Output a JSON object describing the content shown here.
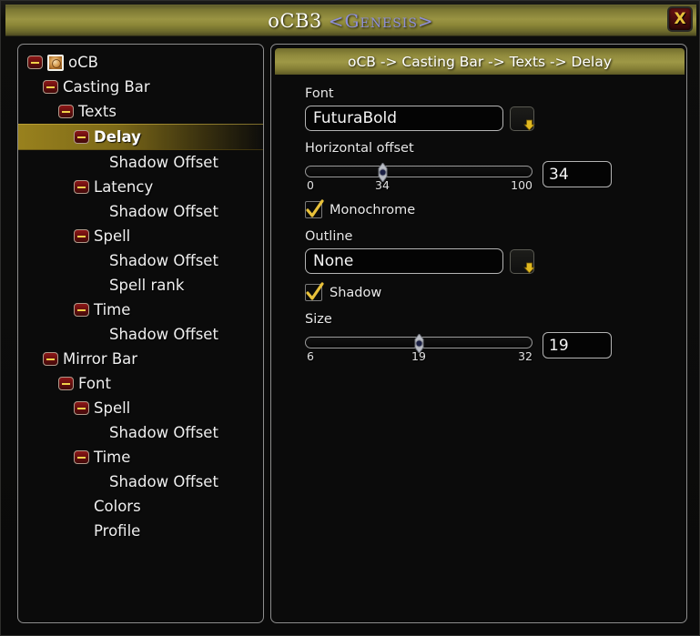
{
  "window": {
    "title_main": "oCB3",
    "title_guild": "<Genesis>",
    "close_label": "X"
  },
  "tree": {
    "items": [
      {
        "label": "oCB",
        "indent": 0,
        "toggle": true,
        "icon": "addon-icon",
        "selected": false
      },
      {
        "label": "Casting Bar",
        "indent": 1,
        "toggle": true,
        "icon": null,
        "selected": false
      },
      {
        "label": "Texts",
        "indent": 2,
        "toggle": true,
        "icon": null,
        "selected": false
      },
      {
        "label": "Delay",
        "indent": 3,
        "toggle": true,
        "icon": null,
        "selected": true
      },
      {
        "label": "Shadow Offset",
        "indent": 4,
        "toggle": false,
        "icon": null,
        "selected": false
      },
      {
        "label": "Latency",
        "indent": 3,
        "toggle": true,
        "icon": null,
        "selected": false
      },
      {
        "label": "Shadow Offset",
        "indent": 4,
        "toggle": false,
        "icon": null,
        "selected": false
      },
      {
        "label": "Spell",
        "indent": 3,
        "toggle": true,
        "icon": null,
        "selected": false
      },
      {
        "label": "Shadow Offset",
        "indent": 4,
        "toggle": false,
        "icon": null,
        "selected": false
      },
      {
        "label": "Spell rank",
        "indent": 4,
        "toggle": false,
        "icon": null,
        "selected": false
      },
      {
        "label": "Time",
        "indent": 3,
        "toggle": true,
        "icon": null,
        "selected": false
      },
      {
        "label": "Shadow Offset",
        "indent": 4,
        "toggle": false,
        "icon": null,
        "selected": false
      },
      {
        "label": "Mirror Bar",
        "indent": 1,
        "toggle": true,
        "icon": null,
        "selected": false
      },
      {
        "label": "Font",
        "indent": 2,
        "toggle": true,
        "icon": null,
        "selected": false
      },
      {
        "label": "Spell",
        "indent": 3,
        "toggle": true,
        "icon": null,
        "selected": false
      },
      {
        "label": "Shadow Offset",
        "indent": 4,
        "toggle": false,
        "icon": null,
        "selected": false
      },
      {
        "label": "Time",
        "indent": 3,
        "toggle": true,
        "icon": null,
        "selected": false
      },
      {
        "label": "Shadow Offset",
        "indent": 4,
        "toggle": false,
        "icon": null,
        "selected": false
      },
      {
        "label": "Colors",
        "indent": 3,
        "toggle": false,
        "icon": null,
        "selected": false
      },
      {
        "label": "Profile",
        "indent": 3,
        "toggle": false,
        "icon": null,
        "selected": false
      }
    ]
  },
  "content": {
    "breadcrumb": "oCB -> Casting Bar -> Texts -> Delay",
    "font": {
      "label": "Font",
      "value": "FuturaBold"
    },
    "horizontal_offset": {
      "label": "Horizontal offset",
      "min": "0",
      "value": "34",
      "max": "100",
      "input_value": "34",
      "percent": 34
    },
    "monochrome": {
      "label": "Monochrome",
      "checked": true
    },
    "outline": {
      "label": "Outline",
      "value": "None"
    },
    "shadow": {
      "label": "Shadow",
      "checked": true
    },
    "size": {
      "label": "Size",
      "min": "6",
      "value": "19",
      "max": "32",
      "input_value": "19",
      "percent": 50
    }
  },
  "colors": {
    "title_gold": "#9a9443",
    "header_gold": "#9e9846",
    "selected_row": "#a0871e",
    "accent_amber": "#e8c13a",
    "panel_border": "#8d8d8d",
    "panel_bg": "#0b0b0b",
    "close_red": "#4a0d0d"
  }
}
